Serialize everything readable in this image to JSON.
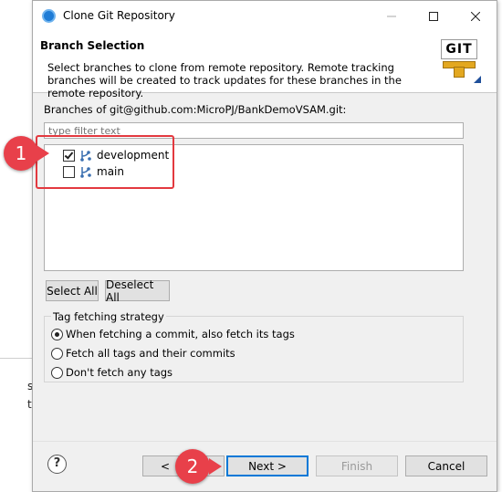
{
  "window": {
    "title": "Clone Git Repository"
  },
  "header": {
    "title": "Branch Selection",
    "description": "Select branches to clone from remote repository. Remote tracking branches will be created to track updates for these branches in the remote repository.",
    "logo_text": "GIT"
  },
  "branches_label": "Branches of git@github.com:MicroPJ/BankDemoVSAM.git:",
  "filter": {
    "placeholder": "type filter text",
    "value": ""
  },
  "branches": [
    {
      "name": "development",
      "checked": true
    },
    {
      "name": "main",
      "checked": false
    }
  ],
  "buttons": {
    "select_all": "Select All",
    "deselect_all": "Deselect All"
  },
  "tag_strategy": {
    "label": "Tag fetching strategy",
    "options": [
      {
        "label": "When fetching a commit, also fetch its tags",
        "selected": true
      },
      {
        "label": "Fetch all tags and their commits",
        "selected": false
      },
      {
        "label": "Don't fetch any tags",
        "selected": false
      }
    ]
  },
  "footer": {
    "help": "?",
    "back_fragment": "<",
    "next": "Next >",
    "finish": "Finish",
    "cancel": "Cancel"
  },
  "callouts": {
    "first": "1",
    "second": "2"
  },
  "background_fragments": {
    "frag1": "s",
    "frag2": "t"
  },
  "colors": {
    "callout": "#e8404a",
    "accent": "#0078d7",
    "git_bar": "#e3a820"
  }
}
